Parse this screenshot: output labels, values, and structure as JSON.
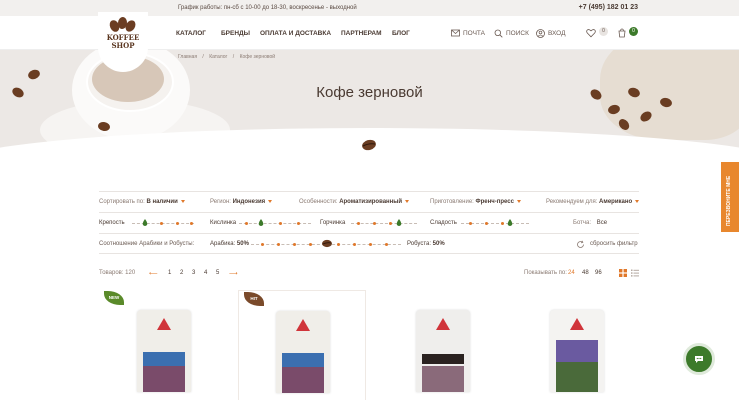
{
  "topbar": {
    "hours": "График работы: пн-сб с 10-00 до 18-30, воскресенье - выходной",
    "phone": "+7 (495) 182 01 23"
  },
  "logo": {
    "line1": "KOFFEE",
    "line2": "SHOP"
  },
  "nav": [
    "КАТАЛОГ",
    "БРЕНДЫ",
    "ОПЛАТА И ДОСТАВКА",
    "ПАРТНЕРАМ",
    "БЛОГ"
  ],
  "header_utils": {
    "mail": "ПОЧТА",
    "search": "ПОИСК",
    "login": "ВХОД",
    "favorites_count": "0",
    "cart_count": "0"
  },
  "breadcrumbs": [
    "Главная",
    "/",
    "Каталог",
    "/",
    "Кофе зерновой"
  ],
  "page_title": "Кофе зерновой",
  "filters": {
    "sort_label": "Сортировать по:",
    "sort_value": "В наличии",
    "region_label": "Регион:",
    "region_value": "Индонезия",
    "features_label": "Особенности:",
    "features_value": "Ароматизированный",
    "prep_label": "Приготовление:",
    "prep_value": "Френч-пресс",
    "rec_label": "Рекомендуем для:",
    "rec_value": "Американо",
    "strength": "Крепость",
    "acidity": "Кислинка",
    "bitterness": "Горчинка",
    "sweetness": "Сладость",
    "body_label": "Ботча:",
    "body_value": "Все",
    "ratio_label": "Соотношение Арабики и Робусты:",
    "arabica_label": "Арабика:",
    "arabica_value": "50%",
    "robusta_label": "Робуста:",
    "robusta_value": "50%",
    "reset": "сбросить фильтр"
  },
  "toolbar": {
    "count": "Товаров: 120",
    "pages": [
      "1",
      "2",
      "3",
      "4",
      "5"
    ],
    "per_page_label": "Показывать по:",
    "per_page": [
      "24",
      "48",
      "96"
    ],
    "prev_arrow": "⟵",
    "next_arrow": "⟶"
  },
  "cards": [
    {
      "badge": "NEW",
      "badge_color": "#5a8a2a"
    },
    {
      "badge": "HIT",
      "badge_color": "#7a4a2a"
    },
    {
      "badge": ""
    },
    {
      "badge": ""
    }
  ],
  "side_tab": "ПЕРЕЗВОНИТЕ МНЕ",
  "colors": {
    "accent": "#e0782a",
    "chat": "#3c7a2a",
    "text": "#4a3a32"
  }
}
